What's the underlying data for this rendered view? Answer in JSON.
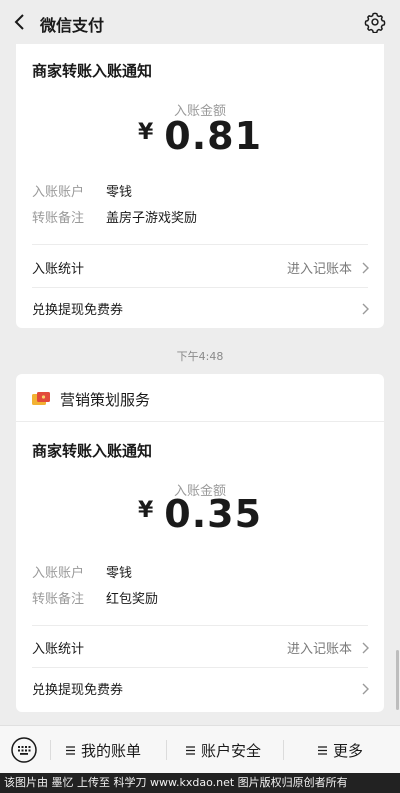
{
  "header": {
    "title": "微信支付",
    "back_icon": "chevron-left-icon",
    "settings_icon": "gear-icon"
  },
  "notifications": [
    {
      "title": "商家转账入账通知",
      "amount_label": "入账金额",
      "currency": "¥",
      "amount": "0.81",
      "fields": [
        {
          "key": "入账账户",
          "value": "零钱"
        },
        {
          "key": "转账备注",
          "value": "盖房子游戏奖励"
        }
      ],
      "stats_label": "入账统计",
      "stats_link": "进入记账本",
      "coupon_label": "兑换提现免费券"
    },
    {
      "brand": "营销策划服务",
      "brand_icon": "red-envelope-icon",
      "title": "商家转账入账通知",
      "amount_label": "入账金额",
      "currency": "¥",
      "amount": "0.35",
      "fields": [
        {
          "key": "入账账户",
          "value": "零钱"
        },
        {
          "key": "转账备注",
          "value": "红包奖励"
        }
      ],
      "stats_label": "入账统计",
      "stats_link": "进入记账本",
      "coupon_label": "兑换提现免费券"
    }
  ],
  "timestamp": "下午4:48",
  "bottom_menu": {
    "keyboard_icon": "keyboard-icon",
    "items": [
      "我的账单",
      "账户安全",
      "更多"
    ]
  },
  "watermark": "该图片由 墨忆 上传至 科学刀 www.kxdao.net 图片版权归原创者所有",
  "colors": {
    "background": "#ededed",
    "card": "#ffffff",
    "muted": "#9a9a9a"
  }
}
